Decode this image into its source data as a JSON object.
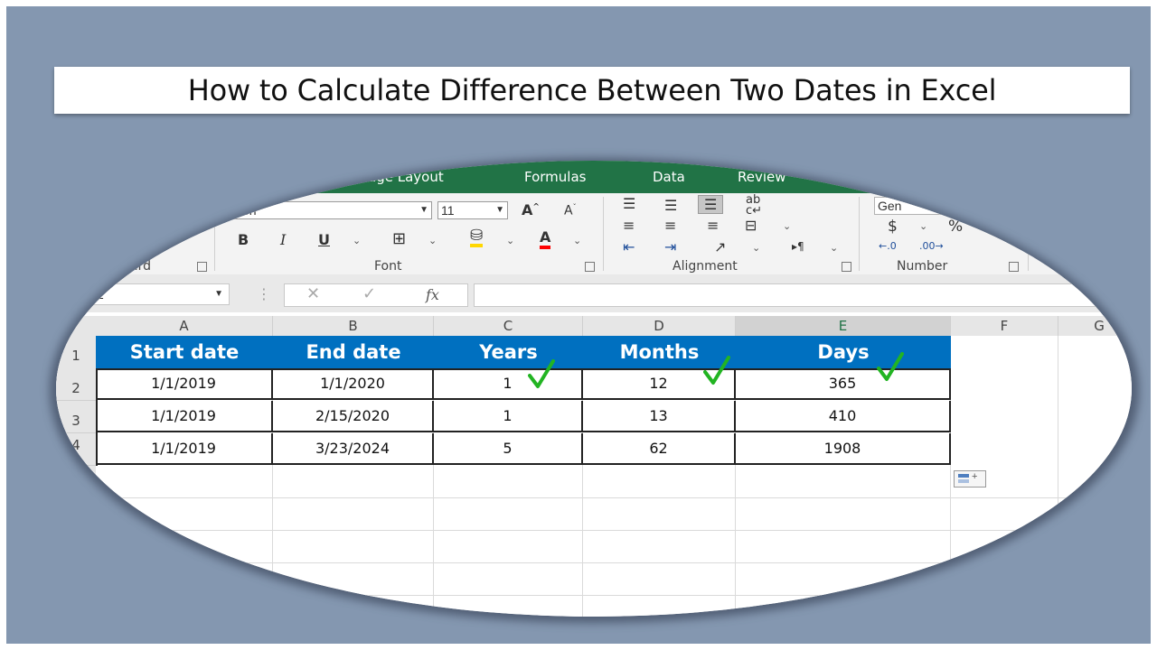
{
  "title": "How to Calculate Difference Between Two Dates in Excel",
  "ribbon": {
    "tabs": [
      "age Layout",
      "Formulas",
      "Data",
      "Review"
    ],
    "font_name": "alibri",
    "font_size": "11",
    "number_format": "Gen",
    "groups": {
      "clipboard": "ard",
      "font": "Font",
      "alignment": "Alignment",
      "number": "Number"
    }
  },
  "formula_bar": {
    "name_box": "2",
    "fx": "fx"
  },
  "columns": [
    "A",
    "B",
    "C",
    "D",
    "E",
    "F",
    "G"
  ],
  "rows": [
    "1",
    "2",
    "3",
    "4"
  ],
  "table": {
    "headers": [
      "Start date",
      "End date",
      "Years",
      "Months",
      "Days"
    ],
    "rows": [
      [
        "1/1/2019",
        "1/1/2020",
        "1",
        "12",
        "365"
      ],
      [
        "1/1/2019",
        "2/15/2020",
        "1",
        "13",
        "410"
      ],
      [
        "1/1/2019",
        "3/23/2024",
        "5",
        "62",
        "1908"
      ]
    ]
  },
  "colors": {
    "frame": "#8497b0",
    "ribbon_green": "#217346",
    "header_blue": "#0070c0",
    "check_green": "#22b422"
  }
}
